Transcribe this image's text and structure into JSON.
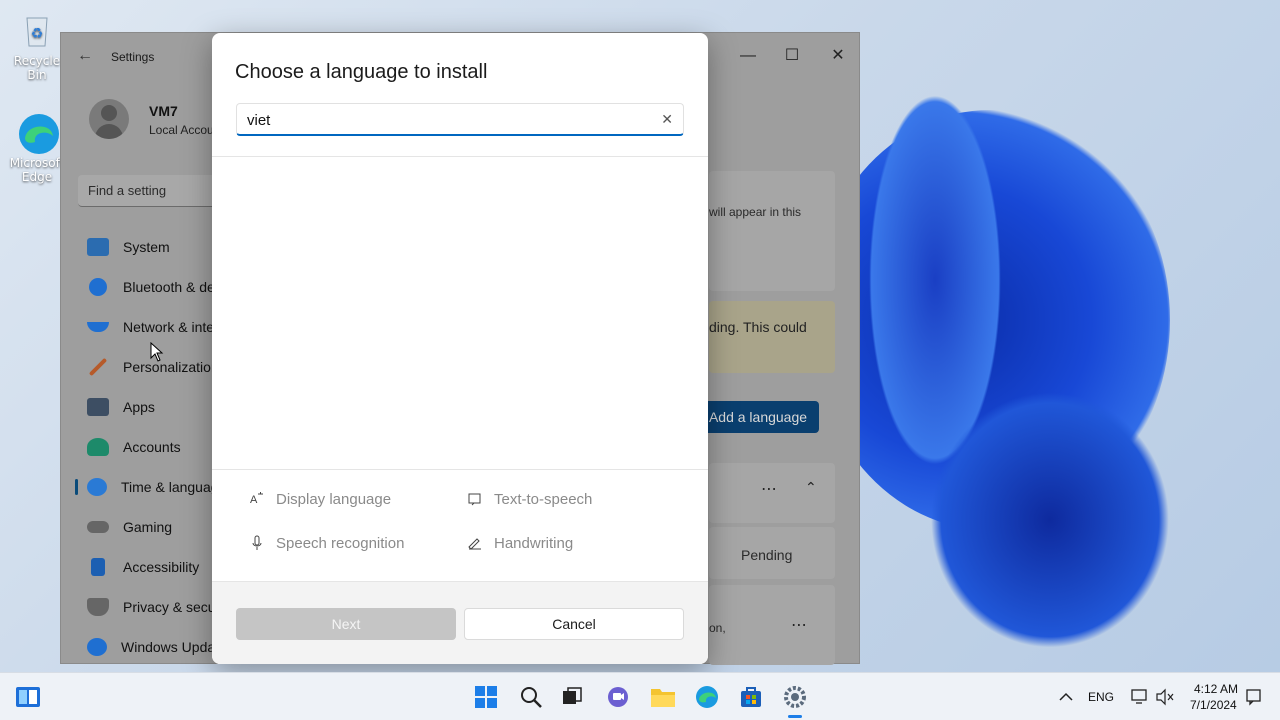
{
  "desktop": {
    "recycle_bin_label": "Recycle Bin",
    "edge_label_1": "Microsoft",
    "edge_label_2": "Edge"
  },
  "settings_window": {
    "title": "Settings",
    "back_glyph": "←",
    "minimize_glyph": "—",
    "maximize_glyph": "☐",
    "close_glyph": "✕",
    "user": {
      "name": "VM7",
      "account": "Local Account"
    },
    "search_placeholder": "Find a setting",
    "nav": [
      {
        "label": "System",
        "icon": "monitor-icon",
        "color": "#2b6cb0"
      },
      {
        "label": "Bluetooth & devices",
        "icon": "bluetooth-icon",
        "color": "#1f6fd1"
      },
      {
        "label": "Network & internet",
        "icon": "wifi-icon",
        "color": "#1f6fd1"
      },
      {
        "label": "Personalization",
        "icon": "brush-icon",
        "color": "#b65a2a"
      },
      {
        "label": "Apps",
        "icon": "apps-icon",
        "color": "#3d4e63"
      },
      {
        "label": "Accounts",
        "icon": "person-icon",
        "color": "#1d8a6a"
      },
      {
        "label": "Time & language",
        "icon": "globe-clock-icon",
        "color": "#2a7ad5"
      },
      {
        "label": "Gaming",
        "icon": "controller-icon",
        "color": "#666666"
      },
      {
        "label": "Accessibility",
        "icon": "accessibility-icon",
        "color": "#1c5fb2"
      },
      {
        "label": "Privacy & security",
        "icon": "shield-icon",
        "color": "#666666"
      },
      {
        "label": "Windows Update",
        "icon": "update-icon",
        "color": "#1f6fd1"
      }
    ],
    "right": {
      "info_text": "will appear in this",
      "warning_text": "ding. This could",
      "add_language_label": "Add a language",
      "pending_label": "Pending",
      "snippet": "on,"
    }
  },
  "dialog": {
    "title": "Choose a language to install",
    "search_value": "viet",
    "clear_glyph": "✕",
    "features": [
      {
        "label": "Display language",
        "icon": "display-language-icon"
      },
      {
        "label": "Text-to-speech",
        "icon": "text-to-speech-icon"
      },
      {
        "label": "Speech recognition",
        "icon": "microphone-icon"
      },
      {
        "label": "Handwriting",
        "icon": "handwriting-icon"
      }
    ],
    "next_label": "Next",
    "cancel_label": "Cancel"
  },
  "taskbar": {
    "tray": {
      "language": "ENG",
      "time": "4:12 AM",
      "date": "7/1/2024"
    }
  }
}
